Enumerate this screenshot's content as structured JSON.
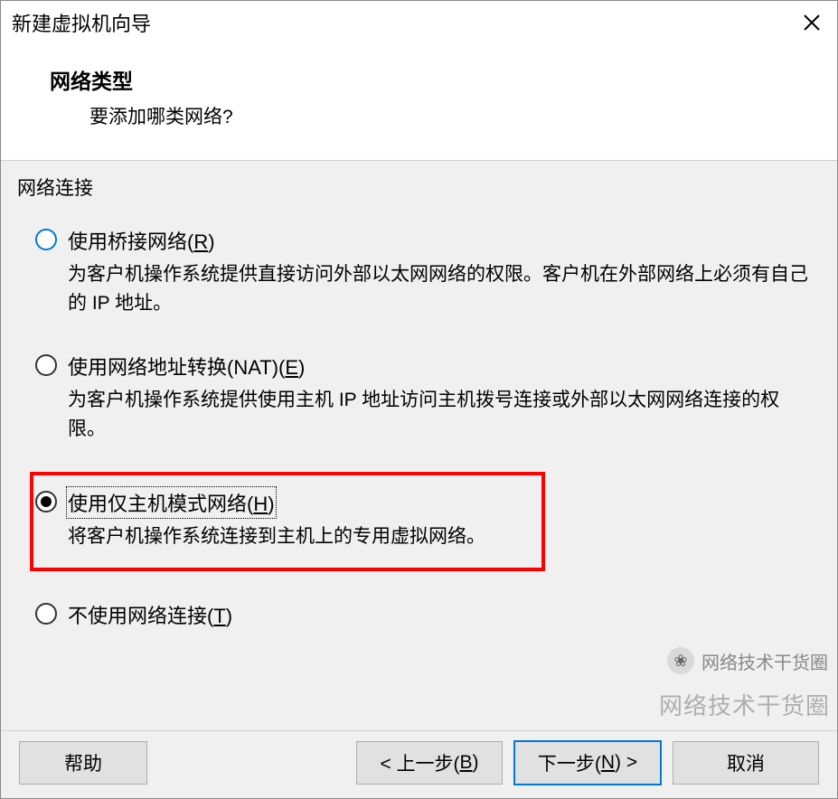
{
  "titlebar": {
    "title": "新建虚拟机向导"
  },
  "header": {
    "heading": "网络类型",
    "subheading": "要添加哪类网络?"
  },
  "group": {
    "label": "网络连接"
  },
  "options": {
    "bridged": {
      "label_pre": "使用桥接网络(",
      "mnemonic": "R",
      "label_post": ")",
      "desc": "为客户机操作系统提供直接访问外部以太网网络的权限。客户机在外部网络上必须有自己的 IP 地址。"
    },
    "nat": {
      "label_pre": "使用网络地址转换(NAT)(",
      "mnemonic": "E",
      "label_post": ")",
      "desc": "为客户机操作系统提供使用主机 IP 地址访问主机拨号连接或外部以太网网络连接的权限。"
    },
    "hostonly": {
      "label_pre": "使用仅主机模式网络(",
      "mnemonic": "H",
      "label_post": ")",
      "desc": "将客户机操作系统连接到主机上的专用虚拟网络。"
    },
    "none": {
      "label_pre": "不使用网络连接(",
      "mnemonic": "T",
      "label_post": ")"
    }
  },
  "footer": {
    "help": "帮助",
    "back_pre": "< 上一步(",
    "back_mn": "B",
    "back_post": ")",
    "next_pre": "下一步(",
    "next_mn": "N",
    "next_post": ") >",
    "cancel": "取消"
  },
  "watermark": {
    "text": "网络技术干货圈",
    "icon": "❀"
  }
}
